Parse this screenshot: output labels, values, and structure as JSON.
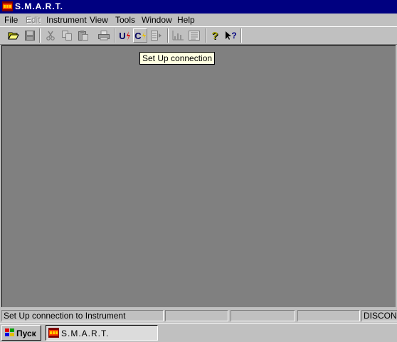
{
  "window": {
    "title": "S.M.A.R.T."
  },
  "menu": {
    "file": "File",
    "edit": "Edit",
    "instrument": "Instrument",
    "view": "View",
    "tools": "Tools",
    "window": "Window",
    "help": "Help"
  },
  "toolbar": {
    "voltage_label": "U",
    "current_label": "C",
    "help_glyph": "?",
    "whats_this_glyph": "?"
  },
  "tooltip": {
    "text": "Set Up connection"
  },
  "status": {
    "message": "Set Up connection to Instrument",
    "pane2": "",
    "pane3": "",
    "pane4": "",
    "connection": "DISCONNECTED"
  },
  "taskbar": {
    "start_label": "Пуск",
    "task_label": "S.M.A.R.T."
  },
  "colors": {
    "titlebar": "#000080",
    "mdi_background": "#808080",
    "face": "#c0c0c0",
    "tooltip_bg": "#ffffe1",
    "accent_red": "#e00000"
  }
}
